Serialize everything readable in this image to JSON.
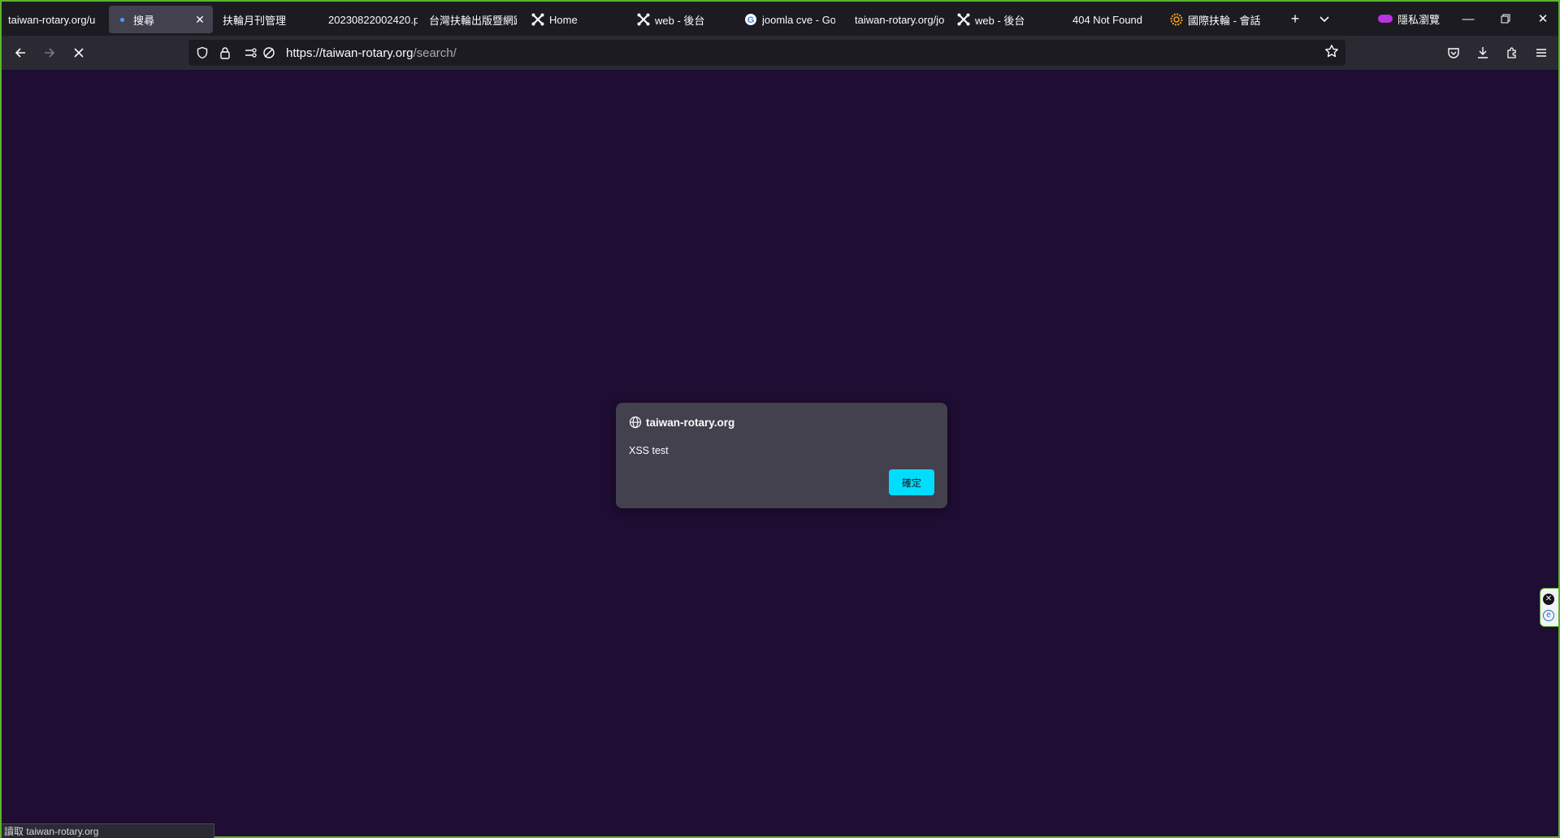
{
  "tabs": [
    {
      "label": "taiwan-rotary.org/u",
      "icon": "none",
      "active": false
    },
    {
      "label": "搜尋",
      "icon": "loading-dot",
      "active": true
    },
    {
      "label": "扶輪月刊管理",
      "icon": "none",
      "active": false
    },
    {
      "label": "20230822002420.p",
      "icon": "none",
      "active": false
    },
    {
      "label": "台灣扶輪出版暨網路",
      "icon": "none",
      "active": false
    },
    {
      "label": "Home",
      "icon": "joomla-icon",
      "active": false
    },
    {
      "label": "web - 後台",
      "icon": "joomla-icon",
      "active": false
    },
    {
      "label": "joomla cve - Go",
      "icon": "google-icon",
      "active": false
    },
    {
      "label": "taiwan-rotary.org/jo",
      "icon": "none",
      "active": false
    },
    {
      "label": "web - 後台",
      "icon": "joomla-icon",
      "active": false
    },
    {
      "label": "404 Not Found",
      "icon": "none",
      "active": false
    },
    {
      "label": "國際扶輪 - 會話",
      "icon": "rotary-icon",
      "active": false
    }
  ],
  "private_label": "隱私瀏覽",
  "url": {
    "host": "https://taiwan-rotary.org",
    "path": "/search/"
  },
  "dialog": {
    "origin": "taiwan-rotary.org",
    "message": "XSS test",
    "ok_label": "確定"
  },
  "status": "讀取 taiwan-rotary.org",
  "colors": {
    "page_bg": "#1f0d33",
    "accent": "#00ddff",
    "dialog_bg": "#42414d"
  }
}
